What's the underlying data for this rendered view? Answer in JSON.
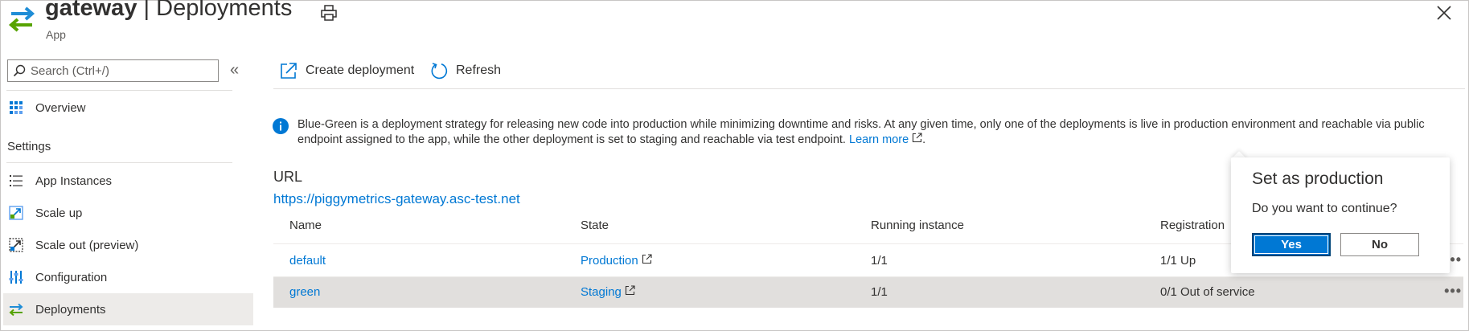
{
  "header": {
    "app_name": "gateway",
    "separator": "|",
    "page_name": "Deployments",
    "subtitle": "App"
  },
  "sidebar": {
    "search_placeholder": "Search (Ctrl+/)",
    "collapse_glyph": "«",
    "overview_label": "Overview",
    "settings_heading": "Settings",
    "items": [
      {
        "label": "App Instances",
        "icon": "list-icon"
      },
      {
        "label": "Scale up",
        "icon": "scale-up-icon"
      },
      {
        "label": "Scale out (preview)",
        "icon": "scale-out-icon"
      },
      {
        "label": "Configuration",
        "icon": "configuration-icon"
      },
      {
        "label": "Deployments",
        "icon": "deployments-icon",
        "active": true
      }
    ]
  },
  "toolbar": {
    "create_label": "Create deployment",
    "refresh_label": "Refresh"
  },
  "info": {
    "text": "Blue-Green is a deployment strategy for releasing new code into production while minimizing downtime and risks. At any given time, only one of the deployments is live in production environment and reachable via public endpoint assigned to the app, while the other deployment is set to staging and reachable via test endpoint.",
    "learn_more": "Learn more",
    "end": "."
  },
  "url": {
    "label": "URL",
    "value": "https://piggymetrics-gateway.asc-test.net"
  },
  "table": {
    "headers": {
      "name": "Name",
      "state": "State",
      "running": "Running instance",
      "registration": "Registration"
    },
    "rows": [
      {
        "name": "default",
        "state": "Production",
        "running": "1/1",
        "registration": "1/1 Up"
      },
      {
        "name": "green",
        "state": "Staging",
        "running": "1/1",
        "registration": "0/1 Out of service"
      }
    ],
    "more_glyph": "•••"
  },
  "callout": {
    "title": "Set as production",
    "message": "Do you want to continue?",
    "yes_label": "Yes",
    "no_label": "No"
  },
  "colors": {
    "accent": "#0078d4",
    "selected_row": "#e1dfdd",
    "active_nav": "#edebe9"
  }
}
